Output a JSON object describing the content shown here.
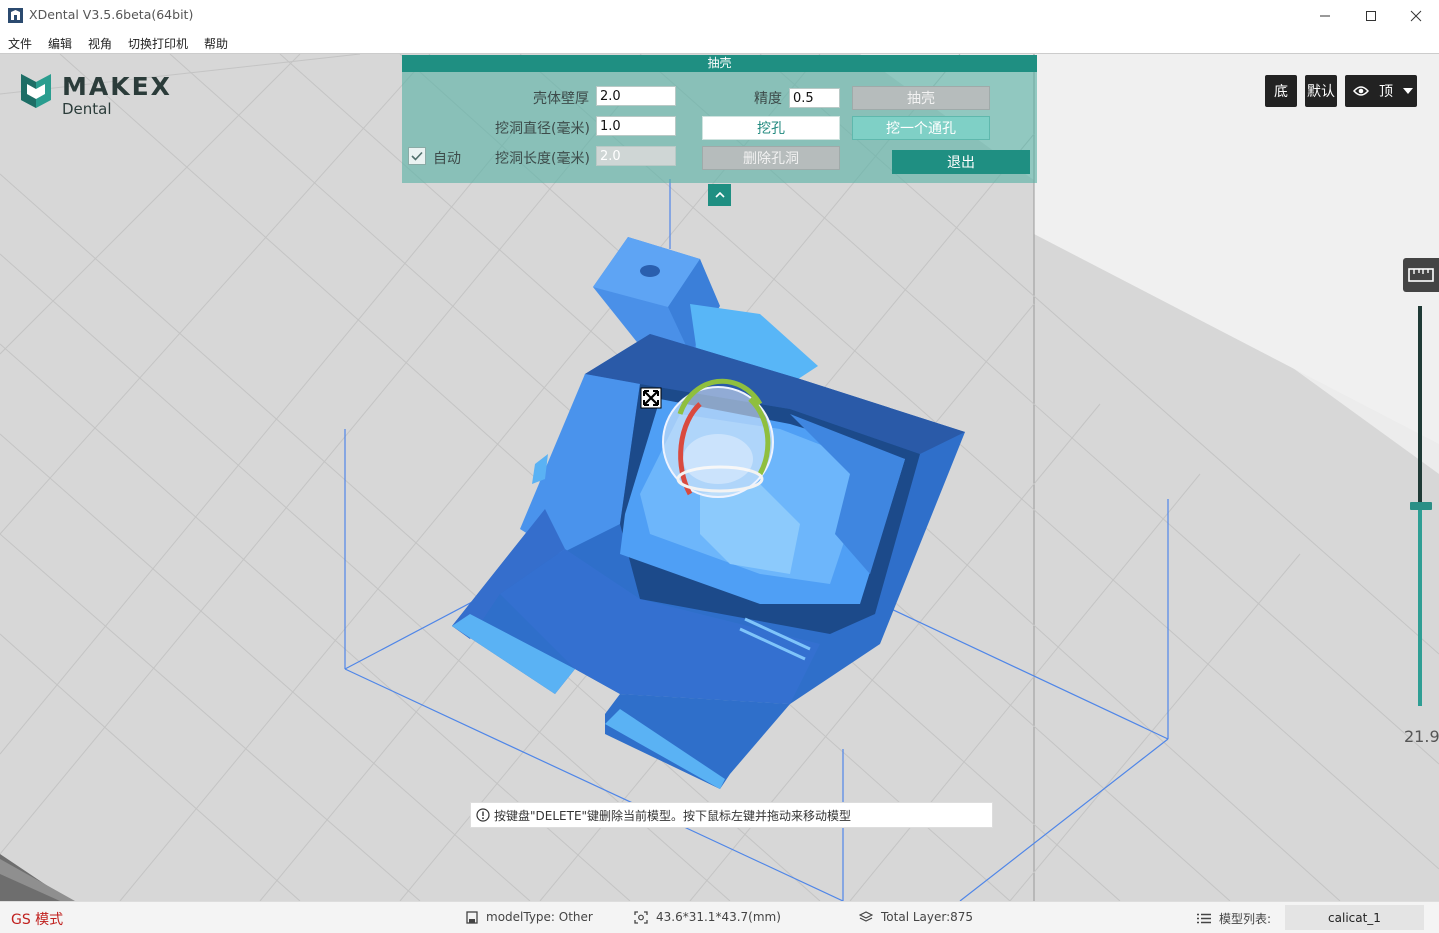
{
  "window": {
    "title": "XDental V3.5.6beta(64bit)",
    "controls": [
      "minimize",
      "maximize",
      "close"
    ]
  },
  "menu": {
    "items": [
      "文件",
      "编辑",
      "视角",
      "切换打印机",
      "帮助"
    ]
  },
  "logo": {
    "brand": "MAKEX",
    "sub": "Dental"
  },
  "view_buttons": {
    "bottom": "底",
    "default": "默认",
    "top": "顶"
  },
  "shell_panel": {
    "title": "抽壳",
    "wall_thickness_label": "壳体壁厚",
    "wall_thickness_value": "2.0",
    "precision_label": "精度",
    "precision_value": "0.5",
    "hole_diameter_label": "挖洞直径(毫米)",
    "hole_diameter_value": "1.0",
    "hole_length_label": "挖洞长度(毫米)",
    "hole_length_value": "2.0",
    "auto_label": "自动",
    "auto_checked": true,
    "shell_button": "抽壳",
    "dig_hole_button": "挖孔",
    "through_hole_button": "挖一个通孔",
    "delete_hole_button": "删除孔洞",
    "exit_button": "退出"
  },
  "slider": {
    "value": "21.9",
    "level_fraction": 0.5
  },
  "hint": {
    "text": "按键盘\"DELETE\"键删除当前模型。按下鼠标左键并拖动来移动模型"
  },
  "status": {
    "mode": "GS 模式",
    "model_type": "modelType: Other",
    "dimensions": "43.6*31.1*43.7(mm)",
    "total_layer": "Total Layer:875",
    "model_list_label": "模型列表:",
    "model_name": "calicat_1"
  },
  "colors": {
    "accent": "#1f8f82",
    "model_blue": "#3f8ff0",
    "mode_red": "#c0201e"
  }
}
